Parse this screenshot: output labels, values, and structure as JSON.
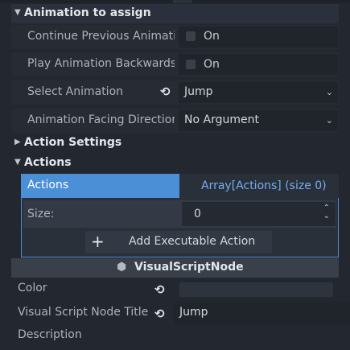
{
  "sections": {
    "animation_to_assign": {
      "title": "Animation to assign",
      "rows": {
        "continue_prev": {
          "label": "Continue Previous Animatio",
          "value": "On"
        },
        "play_backwards": {
          "label": "Play Animation Backwards",
          "value": "On"
        },
        "select_anim": {
          "label": "Select Animation",
          "value": "Jump"
        },
        "facing_dir": {
          "label": "Animation Facing Direction",
          "value": "No Argument"
        }
      }
    },
    "action_settings": {
      "title": "Action Settings"
    },
    "actions": {
      "title": "Actions",
      "property_label": "Actions",
      "array_summary": "Array[Actions] (size 0)",
      "size_label": "Size:",
      "size_value": "0",
      "add_button_label": "Add Executable Action"
    }
  },
  "visual_script_node": {
    "title": "VisualScriptNode",
    "color_label": "Color",
    "title_label": "Visual Script Node Title",
    "title_value": "Jump",
    "description_label": "Description"
  },
  "colors": {
    "accent_blue": "#4b8fd6",
    "link_blue": "#72aef0",
    "panel": "#232730"
  },
  "icons": {
    "expanded": "chevron-down-icon",
    "collapsed": "chevron-right-icon",
    "reset": "reset-arrow-icon",
    "add": "plus-icon",
    "node": "cube-icon"
  }
}
